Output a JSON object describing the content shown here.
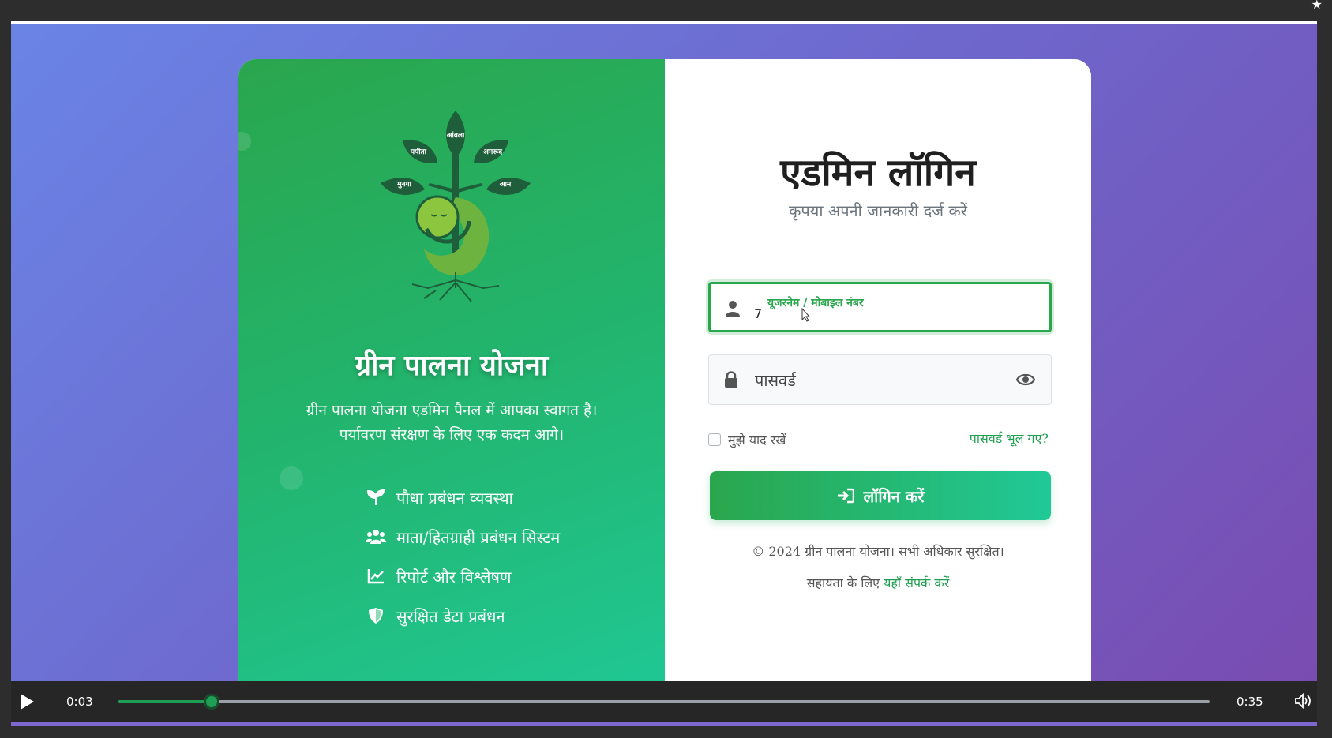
{
  "brand": {
    "name": "ग्रीन पालना योजना",
    "welcome_line1": "ग्रीन पालना योजना एडमिन पैनल में आपका स्वागत है।",
    "welcome_line2": "पर्यावरण संरक्षण के लिए एक कदम आगे।",
    "logo_leaves": [
      "आंवला",
      "पपीता",
      "अमरूद",
      "मुनगा",
      "आम"
    ]
  },
  "features": [
    {
      "icon": "seedling-icon",
      "label": "पौधा प्रबंधन व्यवस्था"
    },
    {
      "icon": "users-icon",
      "label": "माता/हितग्राही प्रबंधन सिस्टम"
    },
    {
      "icon": "chart-line-icon",
      "label": "रिपोर्ट और विश्लेषण"
    },
    {
      "icon": "shield-icon",
      "label": "सुरक्षित डेटा प्रबंधन"
    }
  ],
  "login": {
    "title": "एडमिन लॉगिन",
    "subtitle": "कृपया अपनी जानकारी दर्ज करें",
    "username_label": "यूजरनेम / मोबाइल नंबर",
    "username_value": "7",
    "password_placeholder": "पासवर्ड",
    "remember_label": "मुझे याद रखें",
    "forgot_label": "पासवर्ड भूल गए?",
    "button_label": "लॉगिन करें",
    "copyright": "© 2024 ग्रीन पालना योजना। सभी अधिकार सुरक्षित।",
    "help_prefix": "सहायता के लिए ",
    "help_link": "यहाँ संपर्क करें"
  },
  "player": {
    "current_time": "0:03",
    "duration": "0:35",
    "progress_fraction": 0.0857
  },
  "colors": {
    "accent_green": "#2aa64d",
    "accent_teal": "#20c997",
    "background_start": "#6a84e6",
    "background_end": "#7a4bb0"
  }
}
